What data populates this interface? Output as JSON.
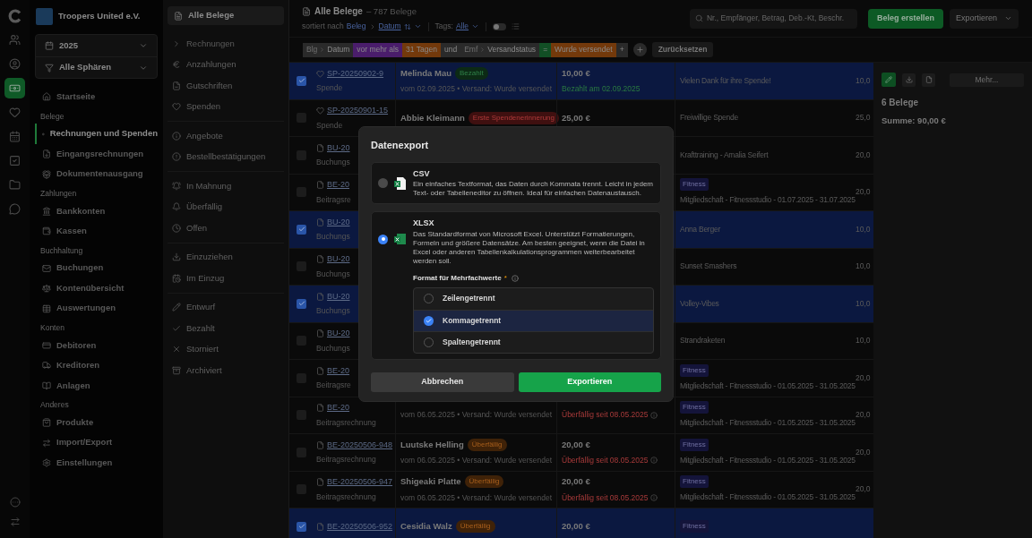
{
  "org": {
    "name": "Troopers United e.V."
  },
  "selects": [
    {
      "value": "2025"
    },
    {
      "value": "Alle Sphären"
    }
  ],
  "rail": [
    {
      "selected": false
    },
    {
      "selected": false
    },
    {
      "selected": true
    },
    {
      "selected": false
    },
    {
      "selected": false
    },
    {
      "selected": false
    },
    {
      "selected": false
    },
    {
      "selected": false
    }
  ],
  "sidebar": {
    "sections": [
      {
        "items": [
          {
            "label": "Startseite",
            "selected": false
          }
        ]
      },
      {
        "heading": "Belege",
        "items": [
          {
            "label": "Rechnungen und Spenden",
            "selected": true
          },
          {
            "label": "Eingangsrechnungen",
            "selected": false
          },
          {
            "label": "Dokumentenausgang",
            "selected": false
          }
        ]
      },
      {
        "heading": "Zahlungen",
        "items": [
          {
            "label": "Bankkonten",
            "selected": false
          },
          {
            "label": "Kassen",
            "selected": false
          }
        ]
      },
      {
        "heading": "Buchhaltung",
        "items": [
          {
            "label": "Buchungen",
            "selected": false
          },
          {
            "label": "Kontenübersicht",
            "selected": false
          },
          {
            "label": "Auswertungen",
            "selected": false
          }
        ]
      },
      {
        "heading": "Konten",
        "items": [
          {
            "label": "Debitoren",
            "selected": false
          },
          {
            "label": "Kreditoren",
            "selected": false
          },
          {
            "label": "Anlagen",
            "selected": false
          }
        ]
      },
      {
        "heading": "Anderes",
        "items": [
          {
            "label": "Produkte",
            "selected": false
          },
          {
            "label": "Import/Export",
            "selected": false
          },
          {
            "label": "Einstellungen",
            "selected": false
          }
        ]
      }
    ]
  },
  "subnav": {
    "top": {
      "label": "Alle Belege",
      "selected": true
    },
    "groups": [
      [
        {
          "label": "Rechnungen",
          "expanded": false
        },
        {
          "label": "Anzahlungen"
        },
        {
          "label": "Gutschriften"
        },
        {
          "label": "Spenden"
        }
      ],
      [
        {
          "label": "Angebote"
        },
        {
          "label": "Bestellbestätigungen"
        }
      ],
      [
        {
          "label": "In Mahnung"
        },
        {
          "label": "Überfällig"
        },
        {
          "label": "Offen"
        }
      ],
      [
        {
          "label": "Einzuziehen"
        },
        {
          "label": "Im Einzug"
        }
      ],
      [
        {
          "label": "Entwurf"
        },
        {
          "label": "Bezahlt"
        },
        {
          "label": "Storniert"
        },
        {
          "label": "Archiviert"
        }
      ]
    ]
  },
  "header": {
    "title": "Alle Belege",
    "count": "– 787 Belege",
    "sort_label": "sortiert nach",
    "sort_path": [
      "Beleg",
      "Datum"
    ],
    "tags_label": "Tags:",
    "tags_value": "Alle",
    "toggle_on": false,
    "search": {
      "placeholder": "Nr., Empfänger, Betrag, Deb.-Kt, Beschr."
    },
    "create_button": "Beleg erstellen",
    "export_button": "Exportieren"
  },
  "filters": [
    {
      "prefix": "Blg",
      "text": "Datum",
      "color": "#2a2a2a"
    },
    {
      "text": "vor mehr als",
      "color": "#4a1d6b"
    },
    {
      "text": "31 Tagen",
      "color": "#73390b"
    },
    {
      "text": "und",
      "color": "#2a2a2a"
    },
    {
      "prefix": "Emf",
      "text": "Versandstatus",
      "color": "#2a2a2a"
    },
    {
      "text": "=",
      "color": "#124f25"
    },
    {
      "text": "Wurde versendet",
      "color": "#73390b"
    },
    {
      "text": "+",
      "color": "#2a2a2a"
    }
  ],
  "reset_button": "Zurücksetzen",
  "rows": [
    {
      "selected": true,
      "kind": "donation",
      "number": "SP-20250902-9",
      "doc_label": "Spende",
      "name": "Melinda Mau",
      "badge": {
        "text": "Bezahlt",
        "kind": "paid"
      },
      "meta": "vom 02.09.2025 • Versand: Wurde versendet",
      "amount": "10,00 €",
      "status": {
        "text": "Bezahlt am 02.09.2025",
        "kind": "paid"
      },
      "description": "Vielen Dank für ihre Spende!",
      "total": "10,0"
    },
    {
      "selected": false,
      "kind": "donation",
      "number": "SP-20250901-15",
      "doc_label": "Spende",
      "name": "Abbie Kleimann",
      "badge": {
        "text": "Erste Spendenerinnerung",
        "kind": "reminder"
      },
      "amount": "25,00 €",
      "description": "Freiwillige Spende",
      "total": "25,0"
    },
    {
      "selected": false,
      "kind": "invoice",
      "number": "BU-20",
      "doc_label": "Buchungs",
      "description": "Krafttraining - Amalia Seifert",
      "total": "20,0"
    },
    {
      "selected": false,
      "kind": "invoice",
      "number": "BE-20",
      "doc_label": "Beitragsre",
      "tag": "Fitness",
      "description": "Mitgliedschaft - Fitnessstudio - 01.07.2025 - 31.07.2025",
      "total": "20,0"
    },
    {
      "selected": true,
      "kind": "invoice",
      "number": "BU-20",
      "doc_label": "Buchungs",
      "description": "Anna Berger",
      "total": "10,0"
    },
    {
      "selected": false,
      "kind": "invoice",
      "number": "BU-20",
      "doc_label": "Buchungs",
      "description": "Sunset Smashers",
      "total": "10,0"
    },
    {
      "selected": true,
      "kind": "invoice",
      "number": "BU-20",
      "doc_label": "Buchungs",
      "description": "Volley-Vibes",
      "total": "10,0"
    },
    {
      "selected": false,
      "kind": "invoice",
      "number": "BU-20",
      "doc_label": "Buchungs",
      "description": "Strandraketen",
      "total": "10,0"
    },
    {
      "selected": false,
      "kind": "invoice",
      "number": "BE-20",
      "doc_label": "Beitragsre",
      "tag": "Fitness",
      "description": "Mitgliedschaft - Fitnessstudio - 01.05.2025 - 31.05.2025",
      "total": "20,0"
    },
    {
      "selected": false,
      "kind": "invoice",
      "number": "BE-20",
      "doc_label": "Beitragsrechnung",
      "meta": "vom 06.05.2025 • Versand: Wurde versendet",
      "status": {
        "text": "Überfällig seit 08.05.2025",
        "kind": "overdue"
      },
      "tag": "Fitness",
      "description": "Mitgliedschaft - Fitnessstudio - 01.05.2025 - 31.05.2025",
      "total": "20,0"
    },
    {
      "selected": false,
      "kind": "invoice",
      "number": "BE-20250506-948",
      "doc_label": "Beitragsrechnung",
      "name": "Luutske Helling",
      "badge": {
        "text": "Überfällig",
        "kind": "overdue"
      },
      "meta": "vom 06.05.2025 • Versand: Wurde versendet",
      "amount": "20,00 €",
      "status": {
        "text": "Überfällig seit 08.05.2025",
        "kind": "overdue"
      },
      "tag": "Fitness",
      "description": "Mitgliedschaft - Fitnessstudio - 01.05.2025 - 31.05.2025",
      "total": "20,0"
    },
    {
      "selected": false,
      "kind": "invoice",
      "number": "BE-20250506-947",
      "doc_label": "Beitragsrechnung",
      "name": "Shigeaki Platte",
      "badge": {
        "text": "Überfällig",
        "kind": "overdue"
      },
      "meta": "vom 06.05.2025 • Versand: Wurde versendet",
      "amount": "20,00 €",
      "status": {
        "text": "Überfällig seit 08.05.2025",
        "kind": "overdue"
      },
      "tag": "Fitness",
      "description": "Mitgliedschaft - Fitnessstudio - 01.05.2025 - 31.05.2025",
      "total": "20,0"
    },
    {
      "selected": true,
      "kind": "invoice",
      "number": "BE-20250506-952",
      "name": "Cesidia Walz",
      "badge": {
        "text": "Überfällig",
        "kind": "overdue"
      },
      "amount": "20,00 €",
      "tag": "Fitness"
    }
  ],
  "panel": {
    "more_button": "Mehr...",
    "count": "6 Belege",
    "sum": "Summe: 90,00 €"
  },
  "dialog": {
    "title": "Datenexport",
    "formats": [
      {
        "name": "CSV",
        "description": "Ein einfaches Textformat, das Daten durch Kommata trennt. Leicht in jedem Text- oder Tabelleneditor zu öffnen. Ideal für einfachen Datenaustausch.",
        "selected": false
      },
      {
        "name": "XLSX",
        "description": "Das Standardformat von Microsoft Excel. Unterstützt Formatierungen, Formeln und größere Datensätze. Am besten geeignet, wenn die Datei in Excel oder anderen Tabellenkalkulationsprogrammen weiterbearbeitet werden soll.",
        "selected": true
      }
    ],
    "field_label": "Format für Mehrfachwerte",
    "required_mark": "*",
    "choices": [
      {
        "label": "Zeilengetrennt",
        "selected": false
      },
      {
        "label": "Kommagetrennt",
        "selected": true
      },
      {
        "label": "Spaltengetrennt",
        "selected": false
      }
    ],
    "cancel_button": "Abbrechen",
    "confirm_button": "Exportieren"
  }
}
